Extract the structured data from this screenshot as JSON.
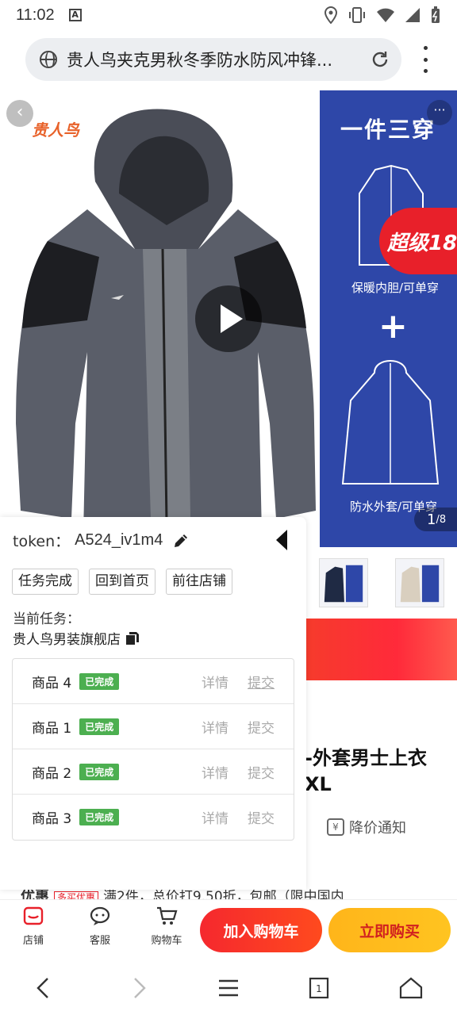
{
  "status": {
    "time": "11:02",
    "a_label": "A"
  },
  "urlbar": {
    "title": "贵人鸟夹克男秋冬季防水防风冲锋..."
  },
  "gallery": {
    "brand": "贵人鸟",
    "side_head": "一件三穿",
    "side_cap1": "保暖内胆/可单穿",
    "side_cap2": "防水外套/可单穿",
    "plus": "+",
    "super_badge": "超级18",
    "counter_current": "1",
    "counter_total": "/8"
  },
  "product": {
    "title_line1": "-外套男士上衣",
    "title_line2": "XL",
    "price_notify": "降价通知"
  },
  "promo": {
    "label": "优惠",
    "tag": "多买优惠",
    "text": "满2件，总价打9.50折，包邮（限中国内"
  },
  "task_panel": {
    "token_label": "token：",
    "token_value": "A524_iv1m4",
    "buttons": [
      "任务完成",
      "回到首页",
      "前往店铺"
    ],
    "current_label": "当前任务：",
    "shop_name": "贵人鸟男装旗舰店",
    "items": [
      {
        "name": "商品 4",
        "status": "已完成",
        "detail": "详情",
        "submit": "提交"
      },
      {
        "name": "商品 1",
        "status": "已完成",
        "detail": "详情",
        "submit": "提交"
      },
      {
        "name": "商品 2",
        "status": "已完成",
        "detail": "详情",
        "submit": "提交"
      },
      {
        "name": "商品 3",
        "status": "已完成",
        "detail": "详情",
        "submit": "提交"
      }
    ]
  },
  "action_bar": {
    "shop": "店铺",
    "service": "客服",
    "cart": "购物车",
    "add_cart": "加入购物车",
    "buy_now": "立即购买"
  },
  "colors": {
    "accent_red": "#e8202a",
    "buy_yellow": "#ffc420",
    "done_green": "#4caf50",
    "side_blue": "#2e47a8"
  }
}
